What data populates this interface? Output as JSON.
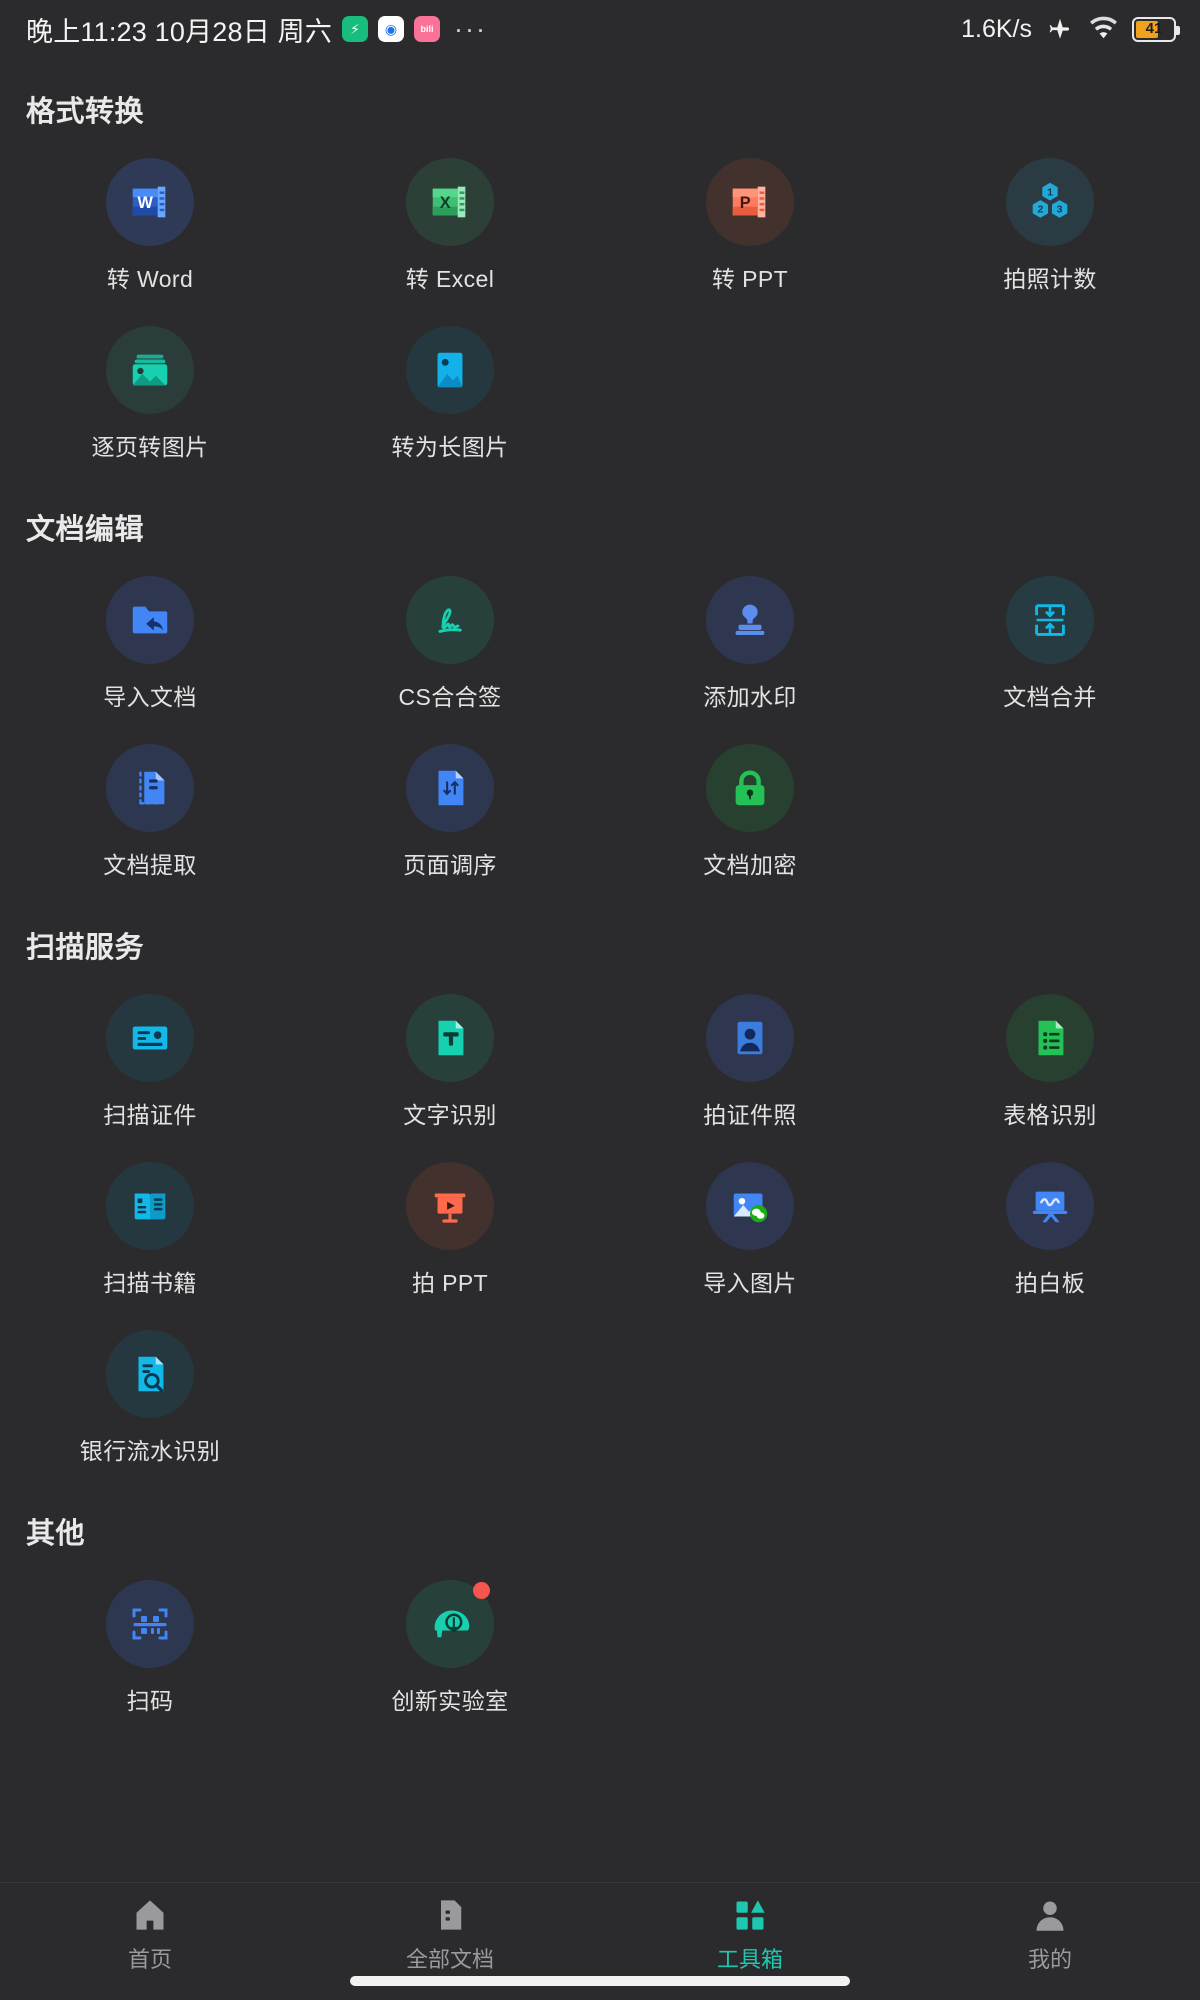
{
  "statusbar": {
    "clock": "晚上11:23 10月28日 周六",
    "overflow": "···",
    "network_speed": "1.6K/s",
    "airplane_icon": "airplane-icon",
    "wifi_icon": "wifi-icon",
    "battery_percent": "41",
    "app_icons": [
      "shield-app-icon",
      "browser-app-icon",
      "bilibili-app-icon"
    ]
  },
  "sections": [
    {
      "title": "格式转换",
      "items": [
        {
          "label": "转 Word",
          "icon": "word-icon",
          "tint": "#2f3a57",
          "color": "#3b7ddd"
        },
        {
          "label": "转 Excel",
          "icon": "excel-icon",
          "tint": "#2c4038",
          "color": "#21a366"
        },
        {
          "label": "转 PPT",
          "icon": "powerpoint-icon",
          "tint": "#42312d",
          "color": "#ff6a4d"
        },
        {
          "label": "拍照计数",
          "icon": "photo-count-icon",
          "tint": "#2b3b43",
          "color": "#1fa5d6"
        },
        {
          "label": "逐页转图片",
          "icon": "page-to-image-icon",
          "tint": "#2a3d3b",
          "color": "#17d0b0"
        },
        {
          "label": "转为长图片",
          "icon": "long-image-icon",
          "tint": "#26383f",
          "color": "#12a5e0"
        }
      ]
    },
    {
      "title": "文档编辑",
      "items": [
        {
          "label": "导入文档",
          "icon": "import-document-icon",
          "tint": "#2f3750",
          "color": "#4285f4"
        },
        {
          "label": "CS合合签",
          "icon": "signature-icon",
          "tint": "#27403b",
          "color": "#17d0b0"
        },
        {
          "label": "添加水印",
          "icon": "watermark-stamp-icon",
          "tint": "#2f3750",
          "color": "#5b8def"
        },
        {
          "label": "文档合并",
          "icon": "merge-document-icon",
          "tint": "#273b42",
          "color": "#12b9e8"
        },
        {
          "label": "文档提取",
          "icon": "extract-document-icon",
          "tint": "#2e3750",
          "color": "#4285f4"
        },
        {
          "label": "页面调序",
          "icon": "reorder-pages-icon",
          "tint": "#2e3750",
          "color": "#4285f4"
        },
        {
          "label": "文档加密",
          "icon": "lock-document-icon",
          "tint": "#28402f",
          "color": "#24c157"
        }
      ]
    },
    {
      "title": "扫描服务",
      "items": [
        {
          "label": "扫描证件",
          "icon": "scan-id-card-icon",
          "tint": "#26383f",
          "color": "#12b9e8"
        },
        {
          "label": "文字识别",
          "icon": "text-recognition-icon",
          "tint": "#27403b",
          "color": "#17d0b0"
        },
        {
          "label": "拍证件照",
          "icon": "id-photo-icon",
          "tint": "#2f3750",
          "color": "#3b7ddd"
        },
        {
          "label": "表格识别",
          "icon": "table-recognition-icon",
          "tint": "#28402f",
          "color": "#24c157"
        },
        {
          "label": "扫描书籍",
          "icon": "scan-book-icon",
          "tint": "#26383f",
          "color": "#12b9e8"
        },
        {
          "label": "拍 PPT",
          "icon": "capture-ppt-icon",
          "tint": "#42312d",
          "color": "#ff6a4d"
        },
        {
          "label": "导入图片",
          "icon": "import-image-icon",
          "tint": "#2f3750",
          "color": "#4285f4"
        },
        {
          "label": "拍白板",
          "icon": "whiteboard-icon",
          "tint": "#2f3750",
          "color": "#4285f4"
        },
        {
          "label": "银行流水识别",
          "icon": "bank-statement-icon",
          "tint": "#26383f",
          "color": "#12b9e8"
        }
      ]
    },
    {
      "title": "其他",
      "items": [
        {
          "label": "扫码",
          "icon": "qr-scan-icon",
          "tint": "#2e3750",
          "color": "#4285f4",
          "badge": false
        },
        {
          "label": "创新实验室",
          "icon": "innovation-lab-icon",
          "tint": "#27403b",
          "color": "#17d0b0",
          "badge": true
        }
      ]
    }
  ],
  "bottom_nav": {
    "items": [
      {
        "label": "首页",
        "icon": "home-icon",
        "active": false
      },
      {
        "label": "全部文档",
        "icon": "docs-icon",
        "active": false
      },
      {
        "label": "工具箱",
        "icon": "toolbox-icon",
        "active": true
      },
      {
        "label": "我的",
        "icon": "profile-icon",
        "active": false
      }
    ],
    "active_color": "#1ec8b0",
    "inactive_color": "#9a9a9c"
  }
}
